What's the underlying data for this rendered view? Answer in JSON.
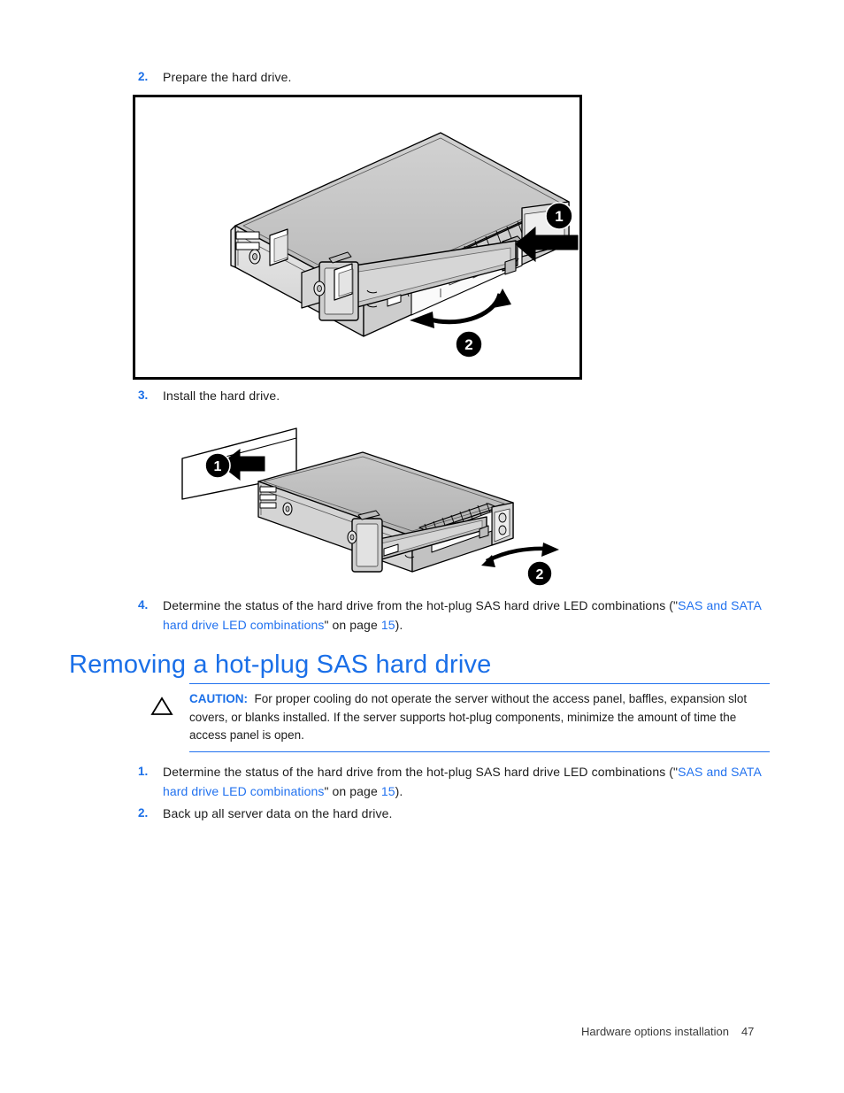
{
  "page": {
    "footer_section": "Hardware options installation",
    "footer_page_number": "47"
  },
  "colors": {
    "link_blue": "#2272ef",
    "heading_blue": "#1a6fe8",
    "body_text": "#1c1c1c",
    "rule_blue": "#2272ef",
    "figure_border": "#000000"
  },
  "steps_top": [
    {
      "number": "2.",
      "text": "Prepare the hard drive."
    },
    {
      "number": "3.",
      "text": "Install the hard drive."
    }
  ],
  "step_four": {
    "number": "4.",
    "lead": "Determine the status of the hard drive from the hot-plug SAS hard drive LED combinations (\"",
    "link": "SAS and SATA hard drive LED combinations",
    "mid": "\" on page ",
    "page_ref": "15",
    "tail": ")."
  },
  "heading": {
    "text": "Removing a hot-plug SAS hard drive"
  },
  "caution": {
    "icon": "caution-triangle-icon",
    "label": "CAUTION:",
    "body": "For proper cooling do not operate the server without the access panel, baffles, expansion slot covers, or blanks installed. If the server supports hot-plug components, minimize the amount of time the access panel is open."
  },
  "steps_bottom": [
    {
      "number": "1.",
      "lead": "Determine the status of the hard drive from the hot-plug SAS hard drive LED combinations (\"",
      "link": "SAS and SATA hard drive LED combinations",
      "mid": "\" on page ",
      "page_ref": "15",
      "tail": ")."
    },
    {
      "number": "2.",
      "text": "Back up all server data on the hard drive."
    }
  ],
  "figures": [
    {
      "name": "figure-prepare-hard-drive",
      "framed": true,
      "callouts": [
        {
          "label": "1",
          "meaning": "press-latch-release-button"
        },
        {
          "label": "2",
          "meaning": "open-drive-lever"
        }
      ]
    },
    {
      "name": "figure-install-hard-drive",
      "framed": false,
      "callouts": [
        {
          "label": "1",
          "meaning": "slide-drive-into-bay"
        },
        {
          "label": "2",
          "meaning": "close-drive-lever"
        }
      ]
    }
  ]
}
